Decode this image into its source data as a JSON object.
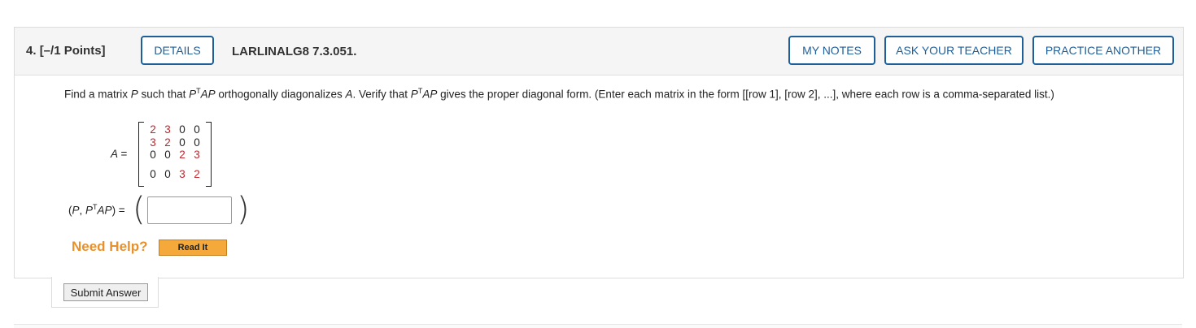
{
  "question": {
    "number": "4.",
    "points": "[–/1 Points]",
    "source": "LARLINALG8 7.3.051."
  },
  "buttons": {
    "details": "DETAILS",
    "my_notes": "MY NOTES",
    "ask_teacher": "ASK YOUR TEACHER",
    "practice_another": "PRACTICE ANOTHER"
  },
  "prompt": {
    "part1": "Find a matrix ",
    "var_p": "P",
    "part2": " such that  ",
    "pt_p": "P",
    "pt_sup": "T",
    "pt_ap": "AP",
    "part3": "  orthogonally diagonalizes ",
    "var_a": "A",
    "part4": ". Verify that  ",
    "pt2_p": "P",
    "pt2_sup": "T",
    "pt2_ap": "AP",
    "part5": "  gives the proper diagonal form. (Enter each matrix in the form [[row 1], [row 2], ...], where each row is a comma-separated list.)"
  },
  "matrix": {
    "label": "A =",
    "rows": [
      [
        "2",
        "3",
        "0",
        "0"
      ],
      [
        "3",
        "2",
        "0",
        "0"
      ],
      [
        "0",
        "0",
        "2",
        "3"
      ],
      [
        "0",
        "0",
        "3",
        "2"
      ]
    ],
    "highlight_color": "#c0262d"
  },
  "answer": {
    "label_open": "(",
    "label_p": "P",
    "label_comma": ", ",
    "label_p2": "P",
    "label_sup": "T",
    "label_ap": "AP",
    "label_close": ") =",
    "paren_left": "(",
    "paren_right": ")",
    "value": "",
    "placeholder": ""
  },
  "help": {
    "need_help": "Need Help?",
    "read_it": "Read It"
  },
  "submit": {
    "label": "Submit Answer"
  },
  "colors": {
    "accent": "#1f5f99",
    "help": "#e8902c",
    "read_it_bg": "#f6a93b"
  }
}
